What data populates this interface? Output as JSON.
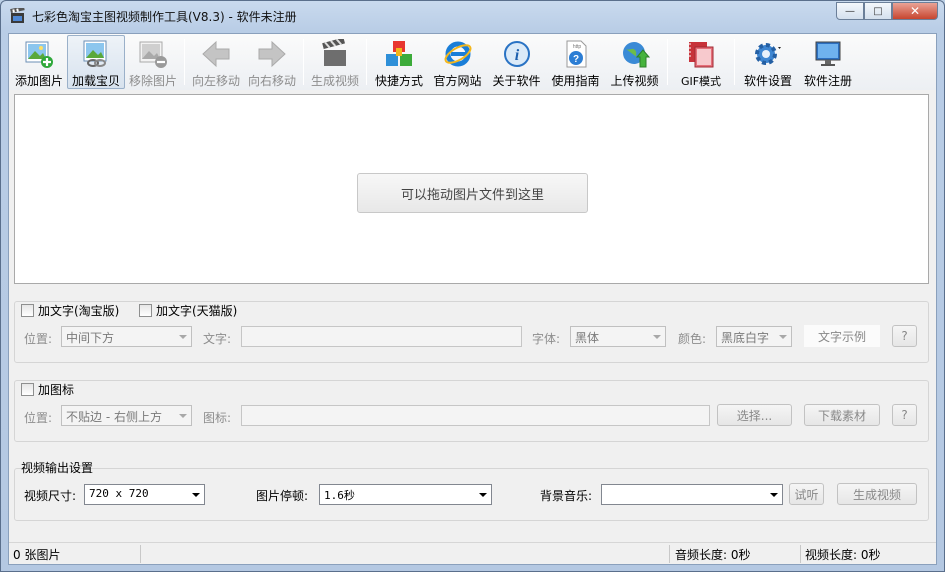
{
  "window": {
    "title": "七彩色淘宝主图视频制作工具(V8.3) - 软件未注册",
    "controls": {
      "minimize": "—",
      "maximize": "□",
      "close": "✕"
    }
  },
  "toolbar": {
    "items": [
      {
        "label": "添加图片",
        "icon": "add-image-icon",
        "enabled": true
      },
      {
        "label": "加载宝贝",
        "icon": "load-item-icon",
        "enabled": true,
        "active": true
      },
      {
        "label": "移除图片",
        "icon": "remove-image-icon",
        "enabled": false
      },
      {
        "label": "向左移动",
        "icon": "arrow-left-icon",
        "enabled": false
      },
      {
        "label": "向右移动",
        "icon": "arrow-right-icon",
        "enabled": false
      },
      {
        "label": "生成视频",
        "icon": "clapperboard-icon",
        "enabled": false
      },
      {
        "label": "快捷方式",
        "icon": "cubes-icon",
        "enabled": true
      },
      {
        "label": "官方网站",
        "icon": "ie-browser-icon",
        "enabled": true
      },
      {
        "label": "关于软件",
        "icon": "info-icon",
        "enabled": true
      },
      {
        "label": "使用指南",
        "icon": "help-doc-icon",
        "enabled": true
      },
      {
        "label": "上传视频",
        "icon": "upload-globe-icon",
        "enabled": true
      },
      {
        "label": "GIF模式",
        "icon": "film-strip-icon",
        "enabled": true
      },
      {
        "label": "软件设置",
        "icon": "gear-icon",
        "enabled": true
      },
      {
        "label": "软件注册",
        "icon": "monitor-icon",
        "enabled": true
      }
    ]
  },
  "dropzone": {
    "hint": "可以拖动图片文件到这里"
  },
  "text_panel": {
    "taobao_checkbox": "加文字(淘宝版)",
    "tmall_checkbox": "加文字(天猫版)",
    "position_label": "位置:",
    "position_value": "中间下方",
    "text_label": "文字:",
    "font_label": "字体:",
    "font_value": "黑体",
    "color_label": "颜色:",
    "color_value": "黑底白字",
    "sample_button": "文字示例",
    "help_button": "?"
  },
  "icon_panel": {
    "checkbox": "加图标",
    "position_label": "位置:",
    "position_value": "不贴边 - 右侧上方",
    "icon_label": "图标:",
    "select_button": "选择...",
    "download_button": "下载素材",
    "help_button": "?"
  },
  "video_panel": {
    "title": "视频输出设置",
    "size_label": "视频尺寸:",
    "size_value": "720 x 720",
    "pause_label": "图片停顿:",
    "pause_value": "1.6秒",
    "music_label": "背景音乐:",
    "music_value": "",
    "listen_button": "试听",
    "generate_button": "生成视频"
  },
  "status": {
    "image_count": "0 张图片",
    "audio_length": "音频长度: 0秒",
    "video_length": "视频长度: 0秒"
  }
}
